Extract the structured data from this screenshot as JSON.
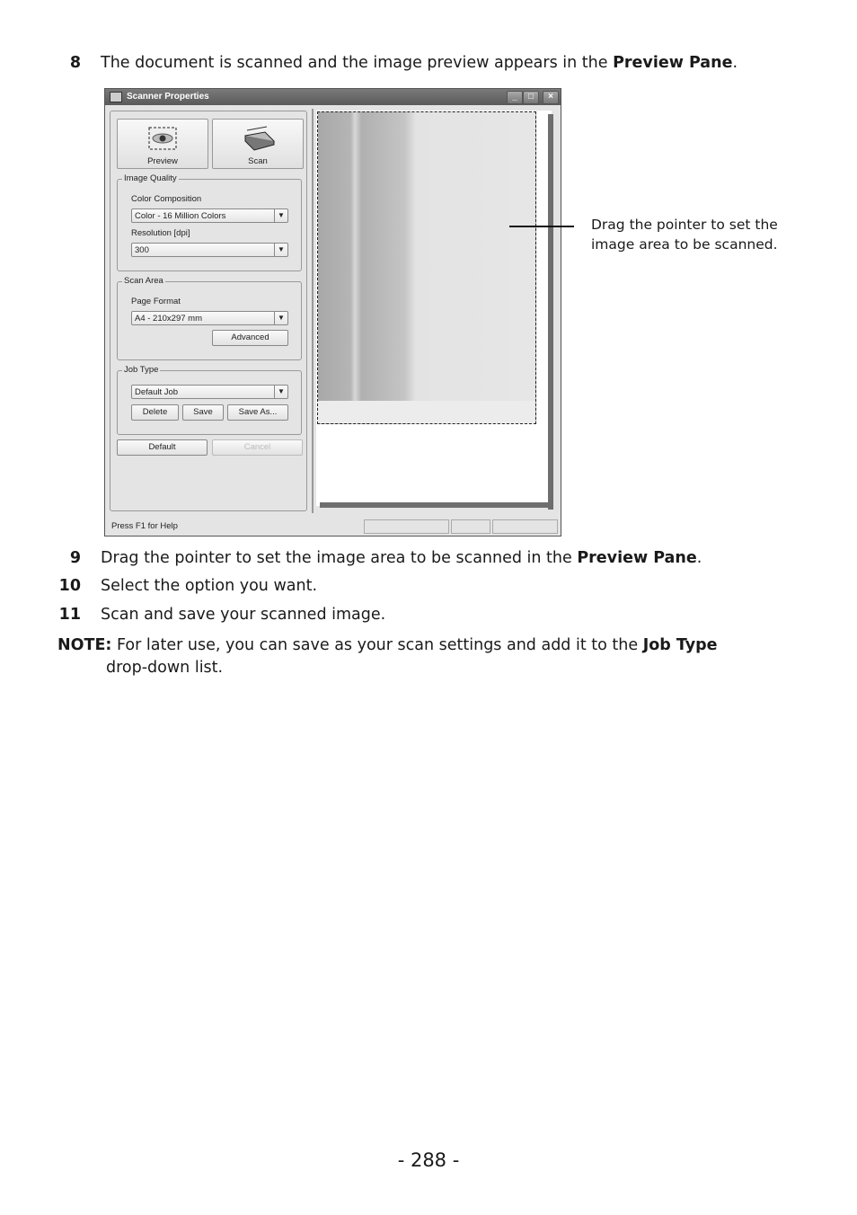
{
  "steps": [
    {
      "num": "8",
      "text": "The document is scanned and the image preview appears in the ",
      "bold": "Preview Pane",
      "tail": "."
    },
    {
      "num": "9",
      "text": "Drag the pointer to set the image area to be scanned in the ",
      "bold": "Preview Pane",
      "tail": "."
    },
    {
      "num": "10",
      "text": "Select the option you want.",
      "bold": "",
      "tail": ""
    },
    {
      "num": "11",
      "text": "Scan and save your scanned image.",
      "bold": "",
      "tail": ""
    }
  ],
  "window": {
    "title": "Scanner Properties",
    "controls": {
      "minimize": "_",
      "maximize": "□",
      "close": "×"
    },
    "preview_button": "Preview",
    "scan_button": "Scan",
    "image_quality": {
      "label": "Image Quality",
      "color_label": "Color Composition",
      "color_value": "Color - 16 Million Colors",
      "resolution_label": "Resolution [dpi]",
      "resolution_value": "300"
    },
    "scan_area": {
      "label": "Scan Area",
      "page_format_label": "Page Format",
      "page_format_value": "A4 - 210x297 mm",
      "advanced_button": "Advanced"
    },
    "job_type": {
      "label": "Job Type",
      "value": "Default Job",
      "delete_button": "Delete",
      "save_button": "Save",
      "save_as_button": "Save As..."
    },
    "default_button": "Default",
    "cancel_button": "Cancel",
    "status_text": "Press F1 for Help"
  },
  "callout": {
    "line1": "Drag the pointer to set the",
    "line2": "image area to be scanned."
  },
  "note": {
    "label": "NOTE:",
    "text": " For later use, you can save as your scan settings and add it to the ",
    "bold": "Job Type",
    "line2": "drop-down list."
  },
  "page": {
    "number": "- 288 -"
  }
}
